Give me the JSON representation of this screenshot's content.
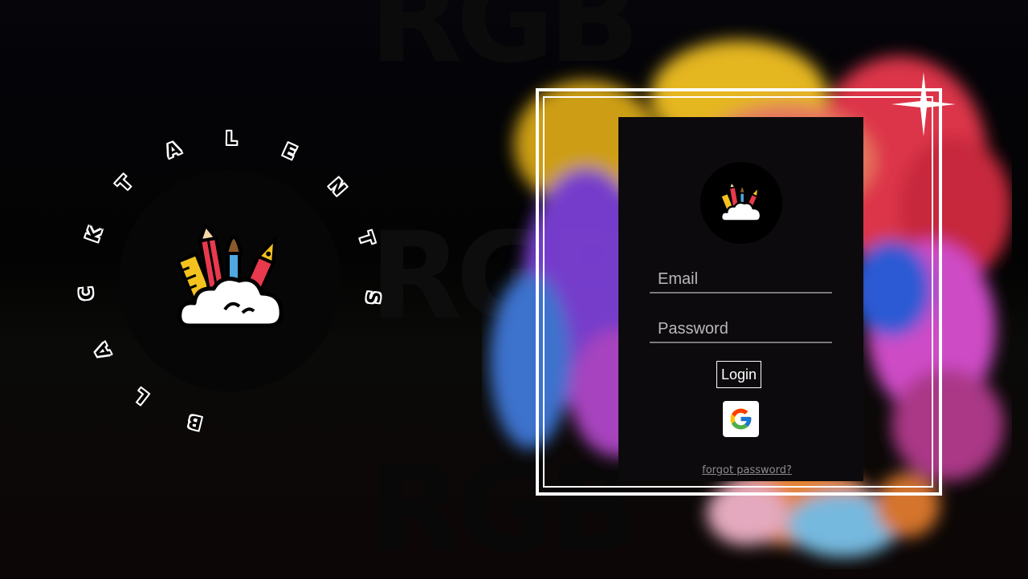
{
  "background": {
    "watermark_text": "RGB",
    "colors": {
      "panel": "#0c0a0c",
      "frame": "#ffffff",
      "smoke": [
        "#f1c021",
        "#e8394d",
        "#7b3fd6",
        "#3f78d8",
        "#d94fd1",
        "#f08a36"
      ]
    }
  },
  "brand": {
    "ring_letters": [
      "B",
      "L",
      "A",
      "C",
      "K",
      "T",
      "A",
      "L",
      "E",
      "N",
      "T",
      "S"
    ],
    "logo_icon": "art-supplies-cloud-icon"
  },
  "login": {
    "logo_icon": "art-supplies-cloud-icon",
    "email_placeholder": "Email",
    "email_value": "",
    "password_placeholder": "Password",
    "password_value": "",
    "login_label": "Login",
    "google_icon": "google-g-icon",
    "forgot_label": "forgot password?"
  }
}
